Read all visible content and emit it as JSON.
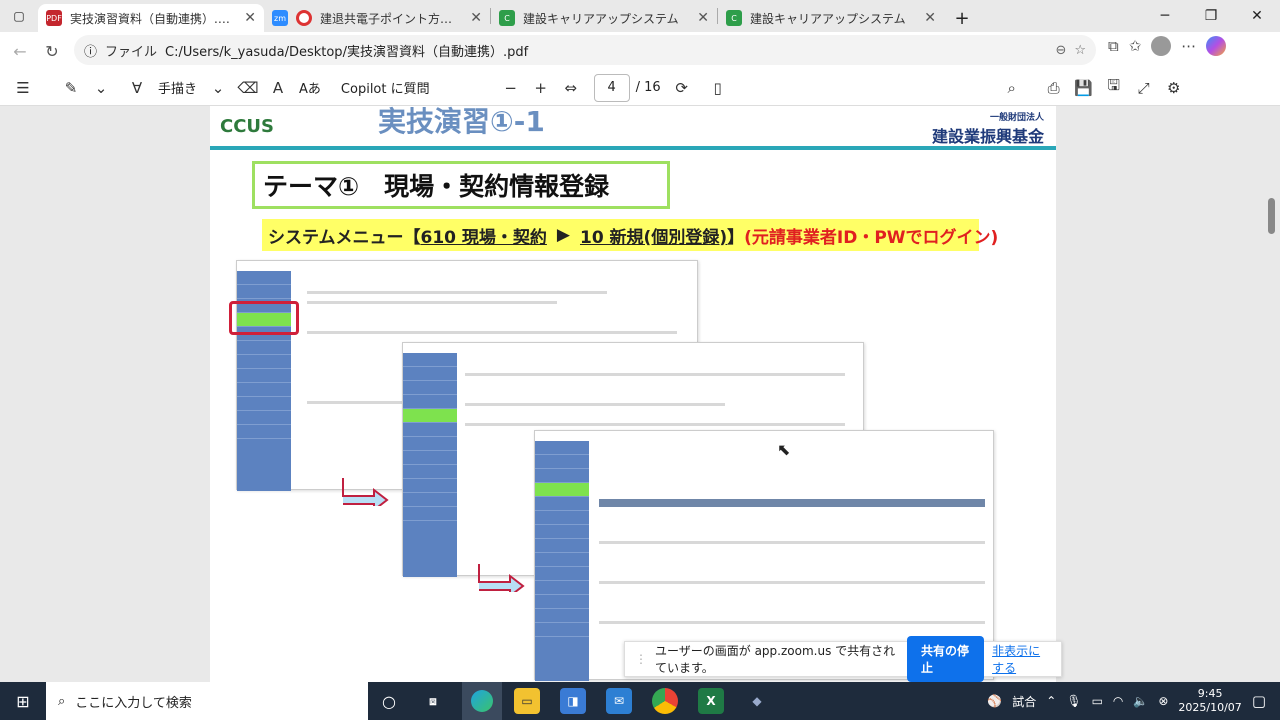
{
  "browser": {
    "tabs": [
      {
        "label": "実技演習資料（自動連携）.pdf",
        "active": true,
        "icon": "pdf-icon",
        "icon_color": "#c4262e"
      },
      {
        "label": "建退共電子ポイント方式操作説",
        "active": false,
        "icon": "zoom-record-icon",
        "icon_color": "#2d8cff"
      },
      {
        "label": "建設キャリアアップシステム",
        "active": false,
        "icon": "ccus-icon",
        "icon_color": "#2e9e4a"
      },
      {
        "label": "建設キャリアアップシステム",
        "active": false,
        "icon": "ccus-icon",
        "icon_color": "#2e9e4a"
      }
    ],
    "new_tab": "+",
    "address_label": "ファイル",
    "address_path": "C:/Users/k_yasuda/Desktop/実技演習資料（自動連携）.pdf"
  },
  "pdf_toolbar": {
    "draw_label": "手描き",
    "read_aloud": "Aあ",
    "copilot_label": "Copilot に質問",
    "page_current": "4",
    "page_total": "/ 16"
  },
  "slide": {
    "title": "実技演習①-1",
    "org_small": "一般財団法人",
    "org": "建設業振興基金",
    "logo": "CCUS",
    "theme": "テーマ①　現場・契約情報登録",
    "menu_prefix": "システムメニュー【",
    "menu_link1": "610 現場・契約",
    "menu_arrow": "▶",
    "menu_link2": "10 新規(個別登録)",
    "menu_bracket": "】",
    "menu_note": "(元請事業者ID・PWでログイン)"
  },
  "share_bar": {
    "message": "ユーザーの画面が app.zoom.us で共有されています。",
    "stop": "共有の停止",
    "hide": "非表示にする"
  },
  "taskbar": {
    "search_placeholder": "ここに入力して検索",
    "ime": "試合",
    "time": "9:45",
    "date": "2025/10/07"
  },
  "colors": {
    "accent_teal": "#2aa7b8",
    "theme_border": "#9ee060",
    "menu_bg": "#ffff66",
    "menu_red": "#e02020",
    "zoom_blue": "#0e71eb"
  }
}
